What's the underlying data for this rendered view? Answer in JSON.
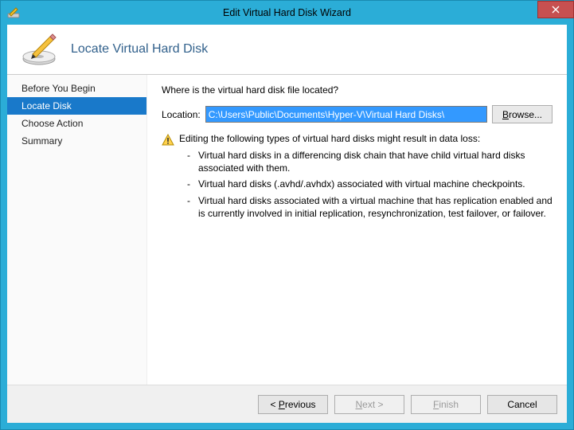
{
  "window": {
    "title": "Edit Virtual Hard Disk Wizard"
  },
  "header": {
    "title": "Locate Virtual Hard Disk"
  },
  "sidebar": {
    "items": [
      {
        "label": "Before You Begin"
      },
      {
        "label": "Locate Disk"
      },
      {
        "label": "Choose Action"
      },
      {
        "label": "Summary"
      }
    ]
  },
  "main": {
    "question": "Where is the virtual hard disk file located?",
    "location_label": "Location:",
    "location_value": "C:\\Users\\Public\\Documents\\Hyper-V\\Virtual Hard Disks\\",
    "browse_label": "Browse...",
    "warning_title": "Editing the following types of virtual hard disks might result in data loss:",
    "warning_items": [
      "Virtual hard disks in a differencing disk chain that have child virtual hard disks associated with them.",
      "Virtual hard disks (.avhd/.avhdx) associated with virtual machine checkpoints.",
      "Virtual hard disks associated with a virtual machine that has replication enabled and is currently involved in initial replication, resynchronization, test failover, or failover."
    ]
  },
  "footer": {
    "previous": "< Previous",
    "next": "Next >",
    "finish": "Finish",
    "cancel": "Cancel"
  }
}
